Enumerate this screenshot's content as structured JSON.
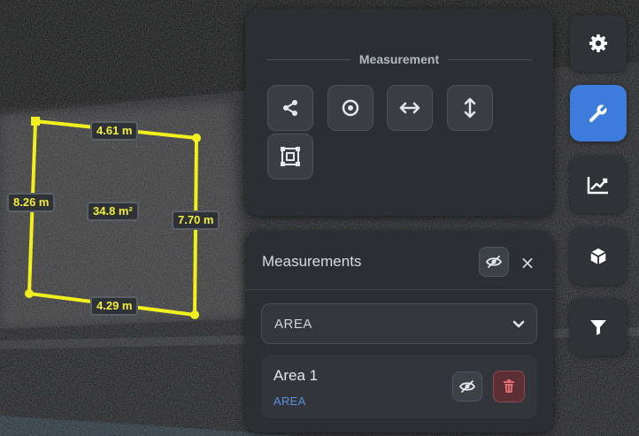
{
  "viewport": {
    "measurement": {
      "top_length": "4.61 m",
      "left_length": "8.26 m",
      "right_length": "7.70 m",
      "bottom_length": "4.29 m",
      "area": "34.8 m²",
      "line_color": "#f2ef1f"
    }
  },
  "tools_panel": {
    "title": "Measurement",
    "tools": [
      {
        "icon": "share-nodes-icon"
      },
      {
        "icon": "target-point-icon"
      },
      {
        "icon": "horizontal-arrows-icon"
      },
      {
        "icon": "vertical-arrows-icon"
      },
      {
        "icon": "area-selection-icon"
      }
    ]
  },
  "measurements_panel": {
    "title": "Measurements",
    "close_symbol": "×",
    "filter": {
      "selected": "AREA"
    },
    "items": [
      {
        "name": "Area 1",
        "type": "AREA"
      }
    ]
  },
  "right_toolbar": {
    "buttons": [
      {
        "icon": "gear-icon",
        "active": false
      },
      {
        "icon": "wrench-icon",
        "active": true
      },
      {
        "icon": "line-chart-icon",
        "active": false
      },
      {
        "icon": "cube-icon",
        "active": false
      },
      {
        "icon": "filter-icon",
        "active": false
      }
    ],
    "active_color": "#3d7cdb"
  }
}
